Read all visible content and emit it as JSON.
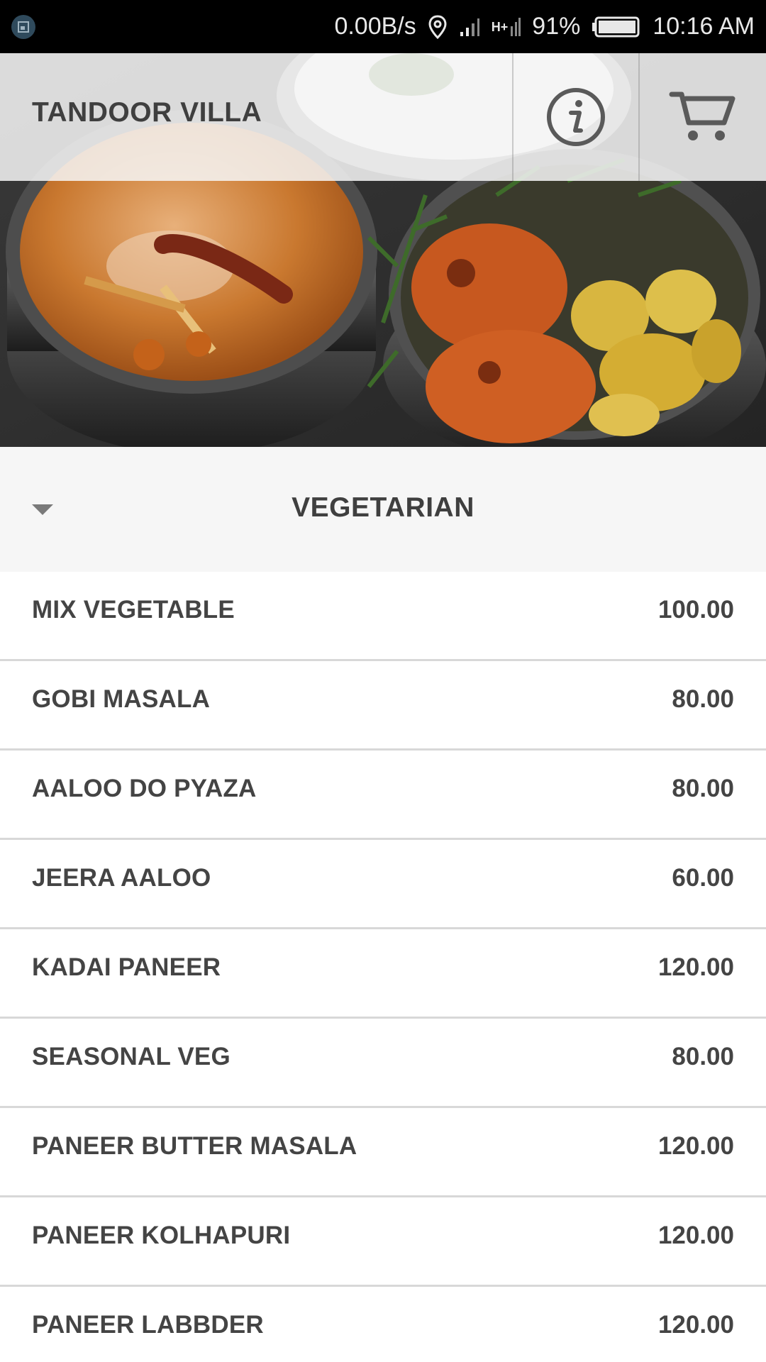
{
  "status_bar": {
    "speed": "0.00B/s",
    "network_label": "H+",
    "battery": "91%",
    "time": "10:16 AM"
  },
  "toolbar": {
    "title": "TANDOOR VILLA",
    "info_icon": "info-icon",
    "cart_icon": "cart-icon"
  },
  "category": {
    "title": "VEGETARIAN",
    "arrow_icon": "caret-down-icon"
  },
  "menu": {
    "items": [
      {
        "name": "MIX VEGETABLE",
        "price": "100.00"
      },
      {
        "name": "GOBI MASALA",
        "price": "80.00"
      },
      {
        "name": "AALOO DO PYAZA",
        "price": "80.00"
      },
      {
        "name": "JEERA AALOO",
        "price": "60.00"
      },
      {
        "name": "KADAI PANEER",
        "price": "120.00"
      },
      {
        "name": "SEASONAL VEG",
        "price": "80.00"
      },
      {
        "name": "PANEER BUTTER MASALA",
        "price": "120.00"
      },
      {
        "name": "PANEER KOLHAPURI",
        "price": "120.00"
      },
      {
        "name": "PANEER LABBDER",
        "price": "120.00"
      }
    ]
  },
  "colors": {
    "status_bar_bg": "#000000",
    "toolbar_overlay": "#f6f6f6",
    "category_bg": "#f6f6f6",
    "text_primary": "#444444",
    "divider": "#d8d8d8"
  }
}
